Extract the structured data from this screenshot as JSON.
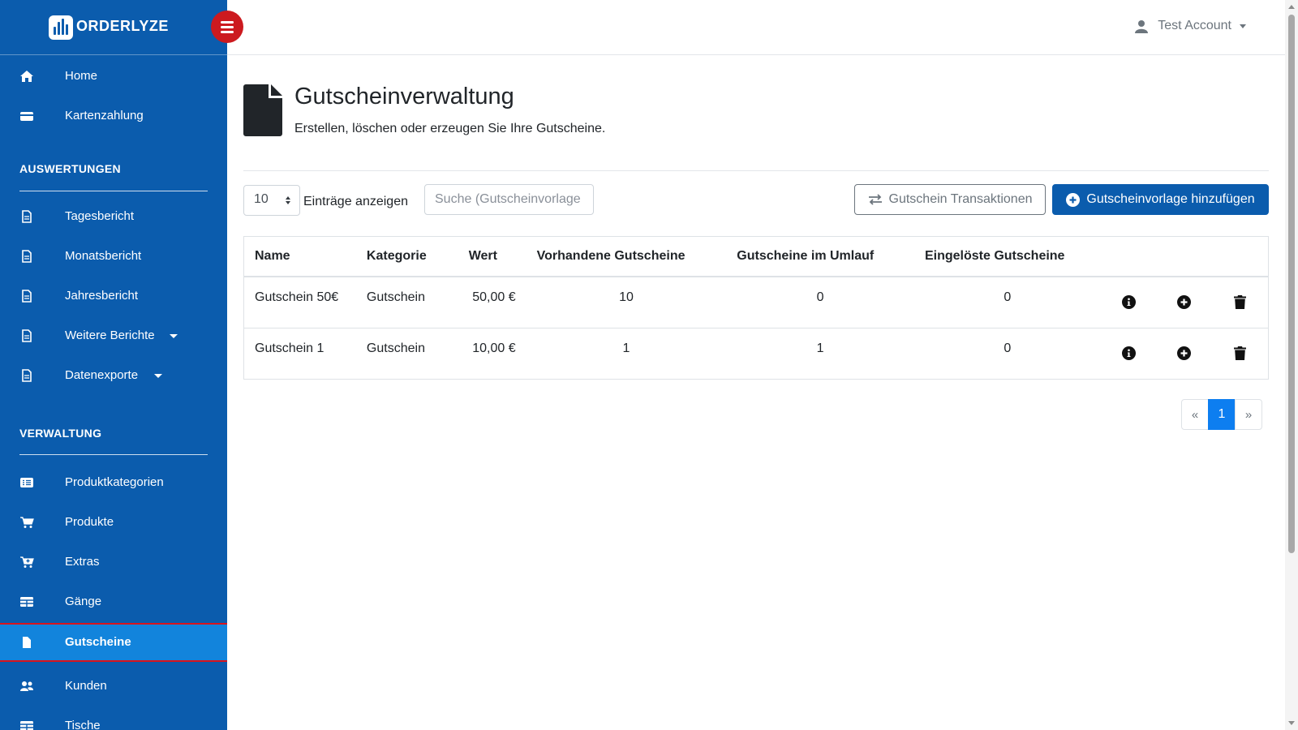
{
  "brand": {
    "name": "ORDERLYZE"
  },
  "account": {
    "name": "Test Account"
  },
  "sidebar": {
    "top_items": [
      {
        "label": "Home",
        "icon": "home-icon"
      },
      {
        "label": "Kartenzahlung",
        "icon": "credit-card-icon"
      }
    ],
    "sections": [
      {
        "title": "AUSWERTUNGEN",
        "items": [
          {
            "label": "Tagesbericht",
            "icon": "document-icon"
          },
          {
            "label": "Monatsbericht",
            "icon": "document-icon"
          },
          {
            "label": "Jahresbericht",
            "icon": "document-icon"
          },
          {
            "label": "Weitere Berichte",
            "icon": "document-icon"
          },
          {
            "label": "Datenexporte",
            "icon": "document-icon"
          }
        ]
      },
      {
        "title": "VERWALTUNG",
        "items": [
          {
            "label": "Produktkategorien",
            "icon": "list-icon"
          },
          {
            "label": "Produkte",
            "icon": "cart-icon"
          },
          {
            "label": "Extras",
            "icon": "cart-plus-icon"
          },
          {
            "label": "Gänge",
            "icon": "table-icon"
          },
          {
            "label": "Gutscheine",
            "icon": "file-icon"
          },
          {
            "label": "Kunden",
            "icon": "users-icon"
          },
          {
            "label": "Tische",
            "icon": "table-icon"
          }
        ]
      }
    ]
  },
  "page": {
    "title": "Gutscheinverwaltung",
    "subtitle": "Erstellen, löschen oder erzeugen Sie Ihre Gutscheine.",
    "icon": "file-icon"
  },
  "toolbar": {
    "entries_value": "10",
    "entries_label": "Einträge anzeigen",
    "search_placeholder": "Suche (Gutscheinvorlage",
    "transactions_label": "Gutschein Transaktionen",
    "add_label": "Gutscheinvorlage hinzufügen"
  },
  "table": {
    "headers": [
      "Name",
      "Kategorie",
      "Wert",
      "Vorhandene Gutscheine",
      "Gutscheine im Umlauf",
      "Eingelöste Gutscheine"
    ],
    "rows": [
      [
        "Gutschein 50€",
        "Gutschein",
        "50,00 €",
        "10",
        "0",
        "0"
      ],
      [
        "Gutschein 1",
        "Gutschein",
        "10,00 €",
        "1",
        "1",
        "0"
      ]
    ]
  },
  "pagination": {
    "prev": "«",
    "current": "1",
    "next": "»"
  },
  "colors": {
    "sidebar": "#0b5cad",
    "active_item": "#1284dc",
    "toggle": "#cc1a1f",
    "primary": "#0b5cad"
  }
}
